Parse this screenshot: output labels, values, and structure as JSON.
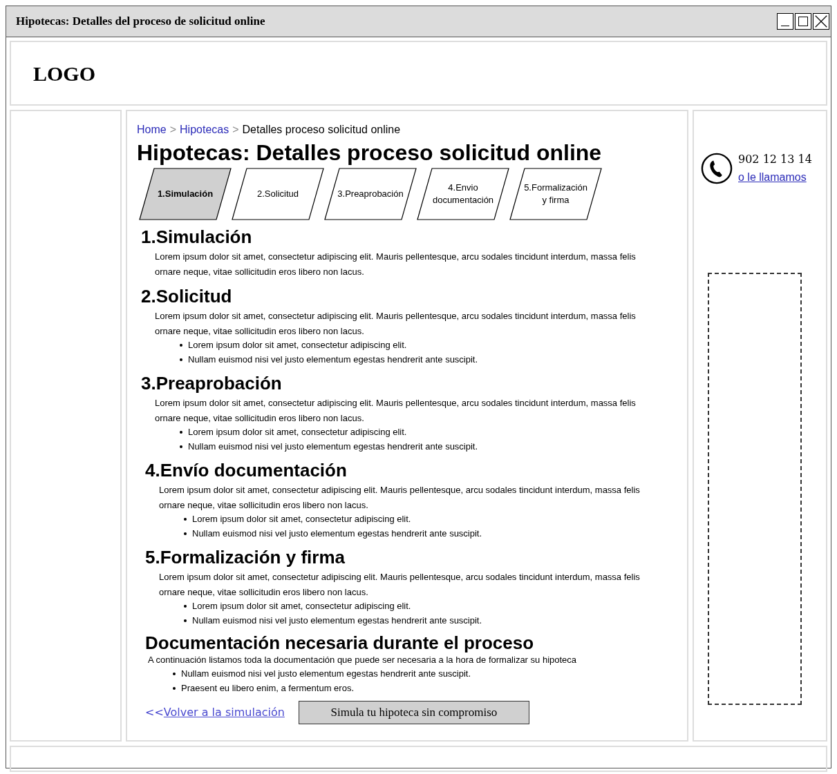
{
  "window": {
    "title": "Hipotecas: Detalles del proceso de solicitud online"
  },
  "header": {
    "logo": "LOGO"
  },
  "breadcrumb": [
    {
      "label": "Home",
      "link": true
    },
    {
      "label": "Hipotecas",
      "link": true
    },
    {
      "label": "Detalles proceso solicitud online",
      "link": false
    }
  ],
  "breadcrumb_separator": ">",
  "page_title": "Hipotecas: Detalles proceso solicitud online",
  "steps": [
    {
      "label": "1.Simulación",
      "selected": true
    },
    {
      "label": "2.Solicitud",
      "selected": false
    },
    {
      "label": "3.Preaprobación",
      "selected": false
    },
    {
      "label": "4.Envio documentación",
      "selected": false
    },
    {
      "label": "5.Formalización y firma",
      "selected": false
    }
  ],
  "sections": [
    {
      "heading": "1.Simulación",
      "text": "Lorem ipsum dolor sit amet, consectetur adipiscing elit. Mauris pellentesque, arcu sodales tincidunt interdum, massa felis ornare neque, vitae sollicitudin eros libero non lacus."
    },
    {
      "heading": "2.Solicitud",
      "text": "Lorem ipsum dolor sit amet, consectetur adipiscing elit. Mauris pellentesque, arcu sodales tincidunt interdum, massa felis ornare neque, vitae sollicitudin eros libero non lacus.",
      "bullets": [
        "Lorem ipsum dolor sit amet, consectetur adipiscing elit.",
        "Nullam euismod nisi vel justo elementum egestas hendrerit ante suscipit."
      ]
    },
    {
      "heading": "3.Preaprobación",
      "text": "Lorem ipsum dolor sit amet, consectetur adipiscing elit. Mauris pellentesque, arcu sodales tincidunt interdum, massa felis ornare neque, vitae sollicitudin eros libero non lacus.",
      "bullets": [
        "Lorem ipsum dolor sit amet, consectetur adipiscing elit.",
        "Nullam euismod nisi vel justo elementum egestas hendrerit ante suscipit."
      ]
    },
    {
      "heading": "4.Envío documentación",
      "text": "Lorem ipsum dolor sit amet, consectetur adipiscing elit. Mauris pellentesque, arcu sodales tincidunt interdum, massa felis ornare neque, vitae sollicitudin eros libero non lacus.",
      "bullets": [
        "Lorem ipsum dolor sit amet, consectetur adipiscing elit.",
        "Nullam euismod nisi vel justo elementum egestas hendrerit ante suscipit."
      ]
    },
    {
      "heading": "5.Formalización y firma",
      "text": "Lorem ipsum dolor sit amet, consectetur adipiscing elit. Mauris pellentesque, arcu sodales tincidunt interdum, massa felis ornare neque, vitae sollicitudin eros libero non lacus.",
      "bullets": [
        "Lorem ipsum dolor sit amet, consectetur adipiscing elit.",
        "Nullam euismod nisi vel justo elementum egestas hendrerit ante suscipit."
      ]
    }
  ],
  "documentation": {
    "heading": "Documentación necesaria durante el proceso",
    "text": "A continuación listamos toda la documentación que puede ser necesaria a la hora de formalizar su hipoteca",
    "bullets": [
      "Nullam euismod nisi vel justo elementum egestas hendrerit ante suscipit.",
      "Praesent eu libero enim, a fermentum eros."
    ]
  },
  "back_link": {
    "prefix": "<<",
    "label": "Volver a la simulación"
  },
  "simulate_button": "Simula tu hipoteca sin compromiso",
  "contact": {
    "phone": "902 12 13 14",
    "link": "o le llamamos"
  }
}
